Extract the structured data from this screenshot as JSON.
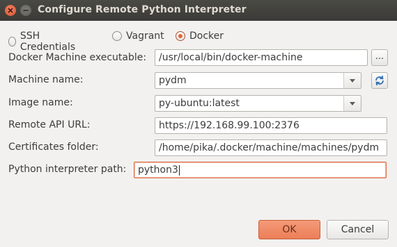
{
  "window": {
    "title": "Configure Remote Python Interpreter"
  },
  "connection_options": [
    {
      "label": "SSH Credentials",
      "selected": false
    },
    {
      "label": "Vagrant",
      "selected": false
    },
    {
      "label": "Docker",
      "selected": true
    }
  ],
  "docker_machine": {
    "label": "Docker Machine executable:",
    "value": "/usr/local/bin/docker-machine",
    "browse_label": "..."
  },
  "machine_name": {
    "label": "Machine name:",
    "value": "pydm",
    "refresh_icon": "refresh-icon"
  },
  "image_name": {
    "label": "Image name:",
    "value": "py-ubuntu:latest"
  },
  "remote_api_url": {
    "label": "Remote API URL:",
    "value": "https://192.168.99.100:2376"
  },
  "certificates_folder": {
    "label": "Certificates folder:",
    "value": "/home/pika/.docker/machine/machines/pydm"
  },
  "interpreter_path": {
    "label": "Python interpreter path:",
    "value": "python3"
  },
  "buttons": {
    "ok": "OK",
    "cancel": "Cancel"
  },
  "colors": {
    "accent": "#e2653a",
    "titlebar": "#3f3e3a",
    "background": "#f2f1f0"
  }
}
